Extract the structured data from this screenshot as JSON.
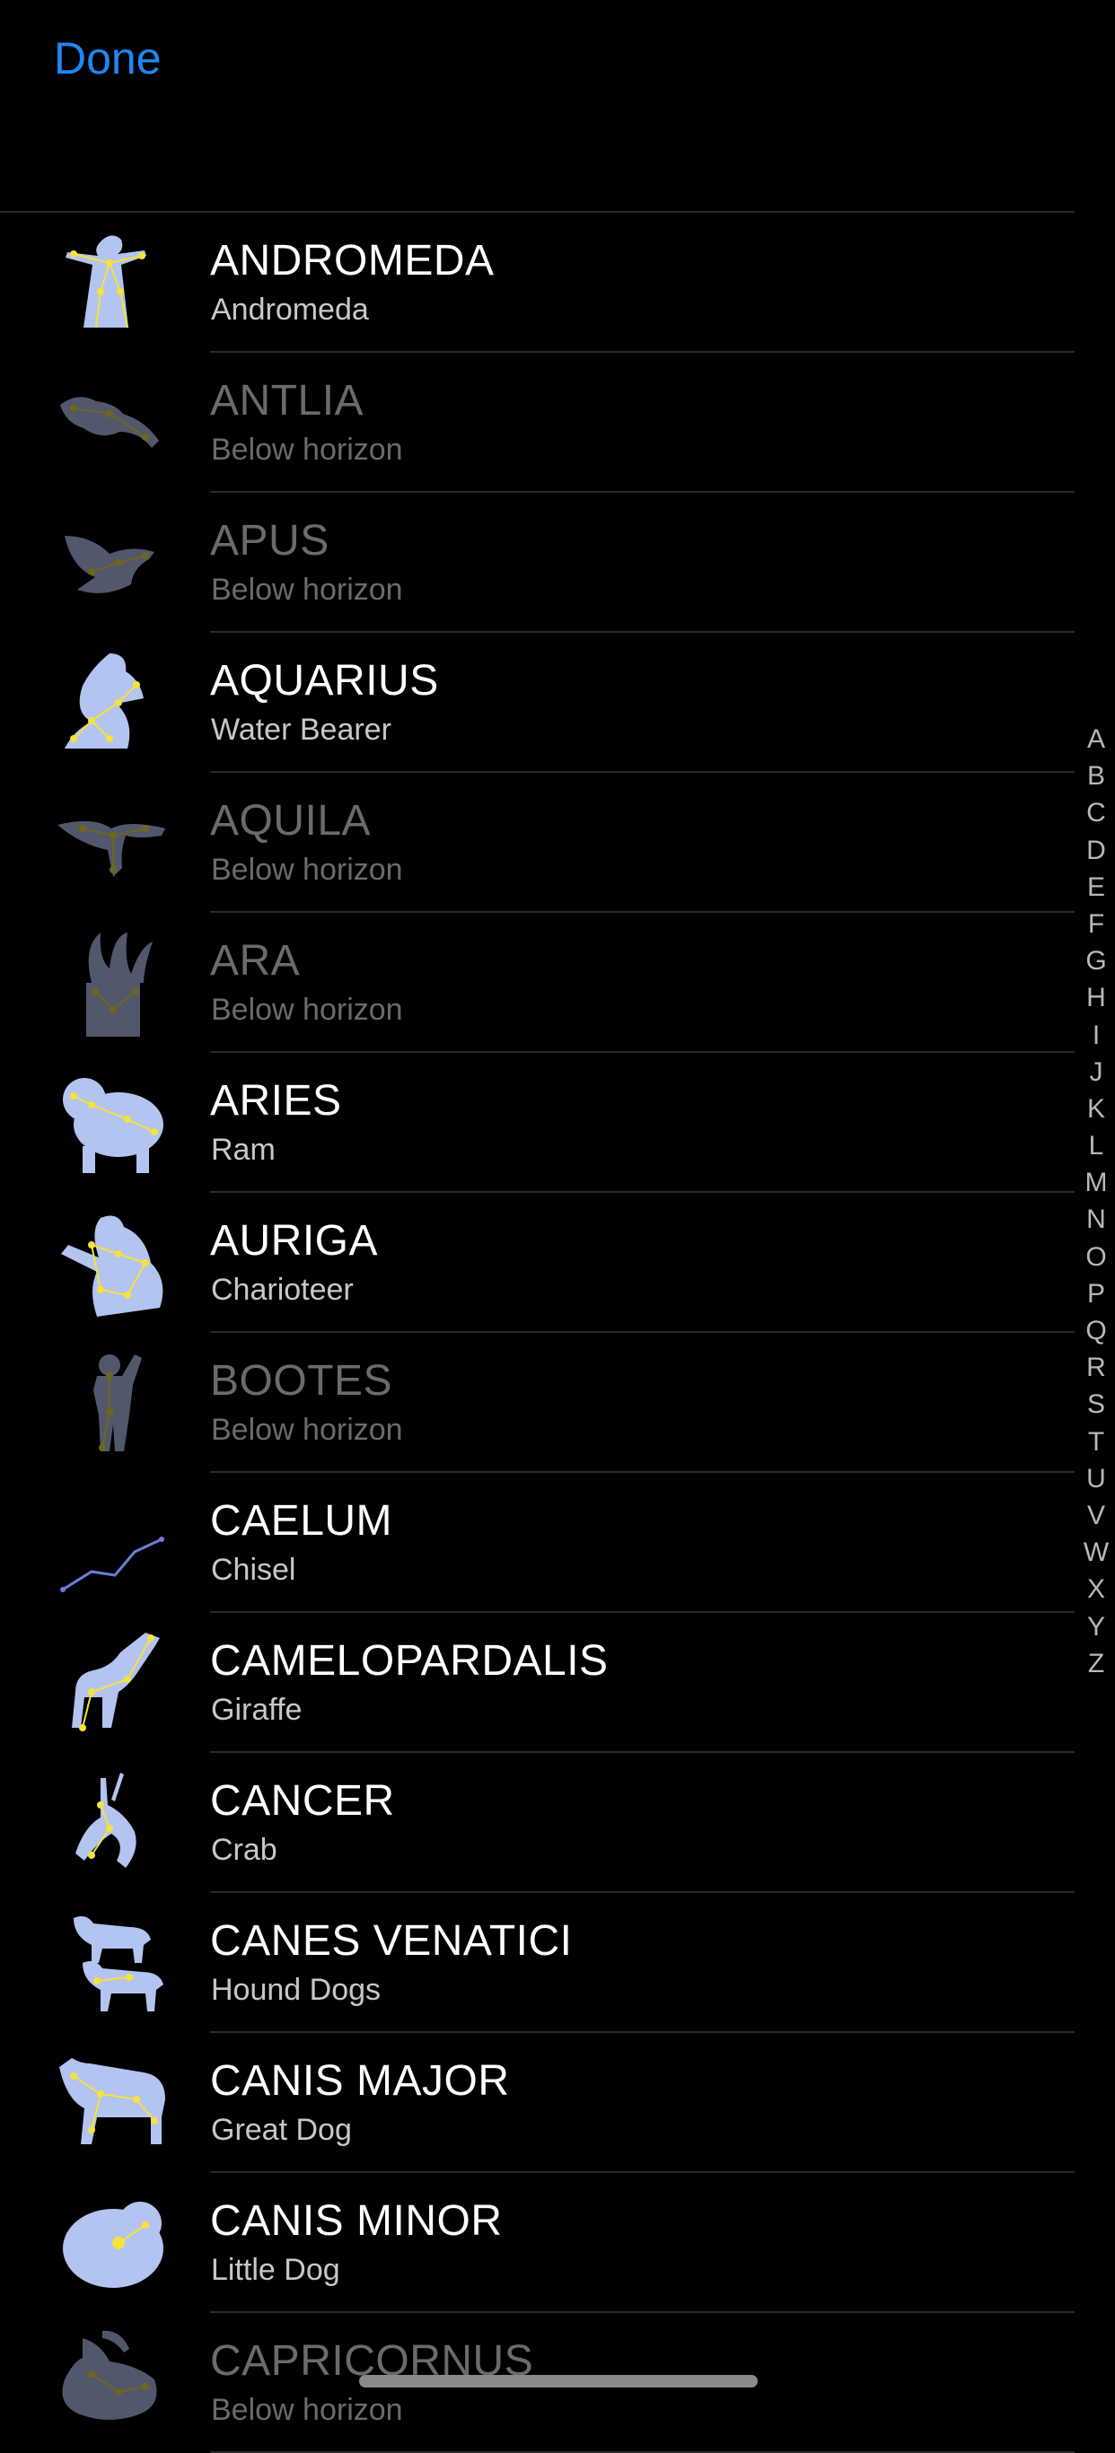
{
  "header": {
    "done_label": "Done"
  },
  "constellations": [
    {
      "name": "ANDROMEDA",
      "subtitle": "Andromeda",
      "visible": true,
      "icon": "andromeda-figure-icon"
    },
    {
      "name": "ANTLIA",
      "subtitle": "Below horizon",
      "visible": false,
      "icon": "antlia-figure-icon"
    },
    {
      "name": "APUS",
      "subtitle": "Below horizon",
      "visible": false,
      "icon": "apus-bird-icon"
    },
    {
      "name": "AQUARIUS",
      "subtitle": "Water Bearer",
      "visible": true,
      "icon": "aquarius-figure-icon"
    },
    {
      "name": "AQUILA",
      "subtitle": "Below horizon",
      "visible": false,
      "icon": "aquila-eagle-icon"
    },
    {
      "name": "ARA",
      "subtitle": "Below horizon",
      "visible": false,
      "icon": "ara-altar-icon"
    },
    {
      "name": "ARIES",
      "subtitle": "Ram",
      "visible": true,
      "icon": "aries-ram-icon"
    },
    {
      "name": "AURIGA",
      "subtitle": "Charioteer",
      "visible": true,
      "icon": "auriga-figure-icon"
    },
    {
      "name": "BOOTES",
      "subtitle": "Below horizon",
      "visible": false,
      "icon": "bootes-figure-icon"
    },
    {
      "name": "CAELUM",
      "subtitle": "Chisel",
      "visible": true,
      "icon": "caelum-lines-icon"
    },
    {
      "name": "CAMELOPARDALIS",
      "subtitle": "Giraffe",
      "visible": true,
      "icon": "camelopardalis-giraffe-icon"
    },
    {
      "name": "CANCER",
      "subtitle": "Crab",
      "visible": true,
      "icon": "cancer-crab-icon"
    },
    {
      "name": "CANES VENATICI",
      "subtitle": "Hound Dogs",
      "visible": true,
      "icon": "canes-venatici-dogs-icon"
    },
    {
      "name": "CANIS MAJOR",
      "subtitle": "Great Dog",
      "visible": true,
      "icon": "canis-major-dog-icon"
    },
    {
      "name": "CANIS MINOR",
      "subtitle": "Little Dog",
      "visible": true,
      "icon": "canis-minor-dog-icon"
    },
    {
      "name": "CAPRICORNUS",
      "subtitle": "Below horizon",
      "visible": false,
      "icon": "capricornus-goat-icon"
    }
  ],
  "index_letters": [
    "A",
    "B",
    "C",
    "D",
    "E",
    "F",
    "G",
    "H",
    "I",
    "J",
    "K",
    "L",
    "M",
    "N",
    "O",
    "P",
    "Q",
    "R",
    "S",
    "T",
    "U",
    "V",
    "W",
    "X",
    "Y",
    "Z"
  ],
  "colors": {
    "accent": "#1e88f2",
    "figure": "#b4c4f0",
    "star": "#f5e23c",
    "dimmed_text": "#6b6b6b",
    "background": "#000000"
  }
}
